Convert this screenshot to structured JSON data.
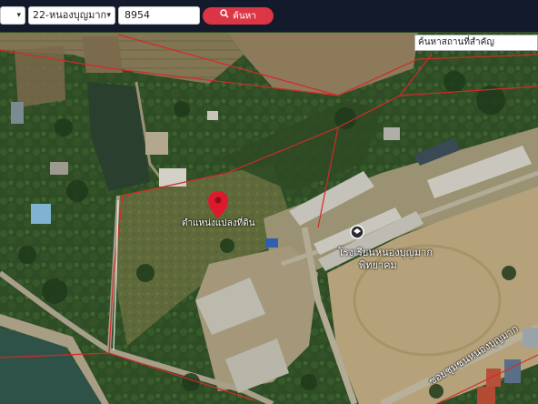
{
  "toolbar": {
    "district_value": "",
    "subdistrict_value": "22-หนองบุญมาก",
    "parcel_input_value": "8954",
    "search_button_label": "ค้นหา"
  },
  "place_search": {
    "placeholder": "ค้นหาสถานที่สำคัญ"
  },
  "map": {
    "marker_label": "ตำแหน่งแปลงที่ดิน",
    "school_label_line1": "โรงเรียนหนองบุญมาก",
    "school_label_line2": "พิทยาคม",
    "road_label": "ซอยชุมชนหนองบุญมาก",
    "marker_color": "#e0182d",
    "boundary_color": "#d42a2a",
    "toolbar_color": "#121a2b",
    "button_color": "#dc3545"
  }
}
